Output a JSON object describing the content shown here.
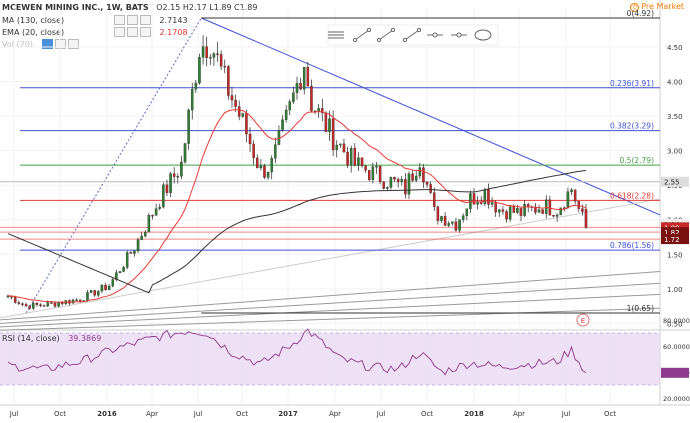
{
  "header": {
    "symbol": "MCEWEN MINING INC., 1W, BATS",
    "ohlc": "O2.15  H2.17  L1.89  C1.89",
    "premarket": "Pre Market",
    "premarket_icon": "clock-icon"
  },
  "indicators": [
    {
      "label": "MA (130, close)",
      "value": "2.7143",
      "color": "#333333"
    },
    {
      "label": "EMA (20, close)",
      "value": "2.1708",
      "color": "#e53935"
    },
    {
      "label": "Vol (20)",
      "value": "",
      "color": "#cccccc"
    }
  ],
  "toolbar_icons": [
    "horizontal-lines-icon",
    "fib-tool-icon",
    "trend-line-icon",
    "ray-icon",
    "horizontal-line-icon",
    "extended-line-icon",
    "ellipse-icon"
  ],
  "rsi": {
    "label": "RSI (14, close)",
    "value": "39.3869"
  },
  "earnings_marker": "E",
  "colors": {
    "fib_blue": "#3f51d6",
    "fib_green": "#43a047",
    "fib_red": "#e53935",
    "candle_up": "#2e7d32",
    "candle_down": "#c62828",
    "ema": "#e53935",
    "ma": "#333333",
    "rsi_line": "#8e3a8e",
    "rsi_band": "#ead9f2"
  },
  "chart_data": {
    "type": "candlestick",
    "price_ticks": [
      "4.50",
      "4.00",
      "3.50",
      "3.00",
      "2.50",
      "2.00",
      "1.50",
      "1.00",
      "0.50"
    ],
    "rsi_ticks": [
      "80.0000",
      "60.0000",
      "40.0000",
      "20.0000"
    ],
    "x_ticks": [
      "Jul",
      "Oct",
      "2016",
      "Apr",
      "Jul",
      "Oct",
      "2017",
      "Apr",
      "Jul",
      "Oct",
      "2018",
      "Apr",
      "Jul",
      "Oct"
    ],
    "bold_x_ticks": [
      "2016",
      "2017",
      "2018"
    ],
    "fib_levels": [
      {
        "ratio": "0(4.92)",
        "price": 4.92,
        "color": "#333333"
      },
      {
        "ratio": "0.236(3.91)",
        "price": 3.91,
        "color": "#3f51d6"
      },
      {
        "ratio": "0.382(3.29)",
        "price": 3.29,
        "color": "#3f51d6"
      },
      {
        "ratio": "0.5(2.79)",
        "price": 2.79,
        "color": "#43a047"
      },
      {
        "ratio": "0.618(2.28)",
        "price": 2.28,
        "color": "#e53935"
      },
      {
        "ratio": "0.786(1.56)",
        "price": 1.56,
        "color": "#3f51d6"
      },
      {
        "ratio": "1(0.65)",
        "price": 0.65,
        "color": "#333333"
      }
    ],
    "price_badges": [
      {
        "text": "2.55",
        "price": 2.55,
        "bg": "#dddddd",
        "fg": "#222222"
      },
      {
        "text": "1.94",
        "price": 1.94,
        "bg": "#eeeeee",
        "fg": "#222222"
      },
      {
        "text": "1.89",
        "price": 1.89,
        "bg": "#c62828",
        "fg": "#ffffff"
      },
      {
        "text": "1.82",
        "price": 1.82,
        "bg": "#7b1010",
        "fg": "#ffffff"
      },
      {
        "text": "1.72",
        "price": 1.72,
        "bg": "#7b1010",
        "fg": "#ffffff"
      }
    ],
    "close_series_weekly_anchors": [
      {
        "week": 0,
        "close": 0.9
      },
      {
        "week": 5,
        "close": 0.75
      },
      {
        "week": 12,
        "close": 0.78
      },
      {
        "week": 20,
        "close": 0.85
      },
      {
        "week": 28,
        "close": 1.05
      },
      {
        "week": 35,
        "close": 1.6
      },
      {
        "week": 42,
        "close": 2.3
      },
      {
        "week": 48,
        "close": 2.8
      },
      {
        "week": 53,
        "close": 4.5
      },
      {
        "week": 56,
        "close": 4.6
      },
      {
        "week": 60,
        "close": 4.0
      },
      {
        "week": 65,
        "close": 3.4
      },
      {
        "week": 70,
        "close": 2.7
      },
      {
        "week": 73,
        "close": 2.8
      },
      {
        "week": 78,
        "close": 3.6
      },
      {
        "week": 82,
        "close": 4.3
      },
      {
        "week": 84,
        "close": 3.7
      },
      {
        "week": 90,
        "close": 3.2
      },
      {
        "week": 96,
        "close": 2.8
      },
      {
        "week": 104,
        "close": 2.6
      },
      {
        "week": 110,
        "close": 2.45
      },
      {
        "week": 114,
        "close": 2.9
      },
      {
        "week": 118,
        "close": 2.1
      },
      {
        "week": 124,
        "close": 1.95
      },
      {
        "week": 128,
        "close": 2.3
      },
      {
        "week": 132,
        "close": 2.4
      },
      {
        "week": 136,
        "close": 2.15
      },
      {
        "week": 142,
        "close": 2.1
      },
      {
        "week": 148,
        "close": 2.2
      },
      {
        "week": 152,
        "close": 2.15
      },
      {
        "week": 156,
        "close": 2.45
      },
      {
        "week": 158,
        "close": 2.15
      },
      {
        "week": 160,
        "close": 1.89
      }
    ],
    "rsi_anchors": [
      {
        "week": 0,
        "v": 45
      },
      {
        "week": 10,
        "v": 42
      },
      {
        "week": 20,
        "v": 48
      },
      {
        "week": 30,
        "v": 58
      },
      {
        "week": 40,
        "v": 66
      },
      {
        "week": 50,
        "v": 72
      },
      {
        "week": 55,
        "v": 70
      },
      {
        "week": 62,
        "v": 55
      },
      {
        "week": 70,
        "v": 46
      },
      {
        "week": 78,
        "v": 60
      },
      {
        "week": 83,
        "v": 72
      },
      {
        "week": 92,
        "v": 50
      },
      {
        "week": 100,
        "v": 44
      },
      {
        "week": 108,
        "v": 42
      },
      {
        "week": 114,
        "v": 55
      },
      {
        "week": 120,
        "v": 40
      },
      {
        "week": 128,
        "v": 47
      },
      {
        "week": 136,
        "v": 44
      },
      {
        "week": 144,
        "v": 46
      },
      {
        "week": 152,
        "v": 48
      },
      {
        "week": 156,
        "v": 57
      },
      {
        "week": 160,
        "v": 39.39
      }
    ]
  }
}
